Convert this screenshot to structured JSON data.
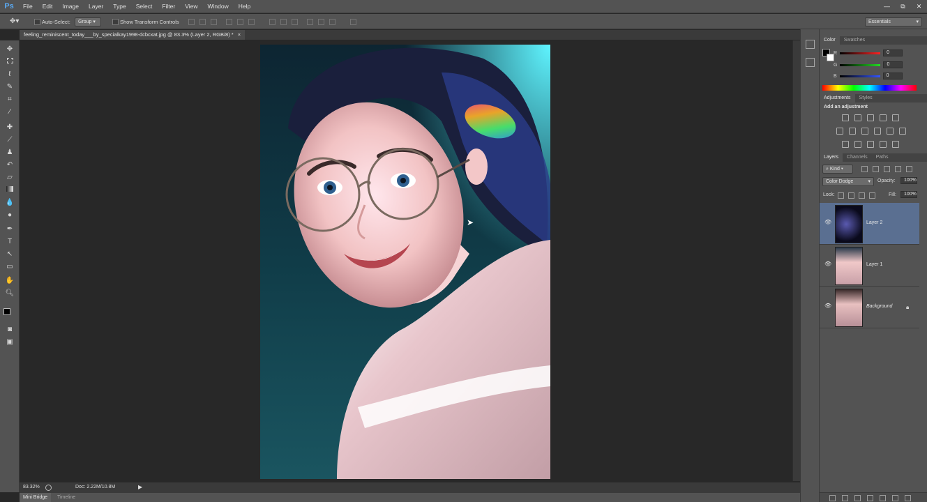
{
  "app": {
    "logo": "Ps"
  },
  "menu": [
    "File",
    "Edit",
    "Image",
    "Layer",
    "Type",
    "Select",
    "Filter",
    "View",
    "Window",
    "Help"
  ],
  "window_controls": [
    "—",
    "⧉",
    "✕"
  ],
  "options": {
    "auto_select_label": "Auto-Select:",
    "auto_select_value": "Group",
    "show_transform_label": "Show Transform Controls",
    "workspace": "Essentials"
  },
  "document": {
    "tab_title": "feeling_reminiscent_today___by_specialkay1998-dcbcxat.jpg @ 83.3% (Layer 2, RGB/8) *",
    "tab_close": "×"
  },
  "status": {
    "zoom": "83.32%",
    "doc_info": "Doc: 2.22M/10.8M"
  },
  "bottom_tabs": [
    "Mini Bridge",
    "Timeline"
  ],
  "color_panel": {
    "tabs": [
      "Color",
      "Swatches"
    ],
    "channels": [
      {
        "label": "R",
        "value": "0",
        "color": "#e03030"
      },
      {
        "label": "G",
        "value": "0",
        "color": "#30c030"
      },
      {
        "label": "B",
        "value": "0",
        "color": "#3050e0"
      }
    ]
  },
  "adjustments_panel": {
    "tabs": [
      "Adjustments",
      "Styles"
    ],
    "heading": "Add an adjustment"
  },
  "layers_panel": {
    "tabs": [
      "Layers",
      "Channels",
      "Paths"
    ],
    "filter_kind": "Kind",
    "blend_mode": "Color Dodge",
    "opacity_label": "Opacity:",
    "opacity_value": "100%",
    "lock_label": "Lock:",
    "fill_label": "Fill:",
    "fill_value": "100%",
    "layers": [
      {
        "name": "Layer 2",
        "selected": true
      },
      {
        "name": "Layer 1",
        "selected": false
      },
      {
        "name": "Background",
        "selected": false,
        "locked": true
      }
    ]
  }
}
